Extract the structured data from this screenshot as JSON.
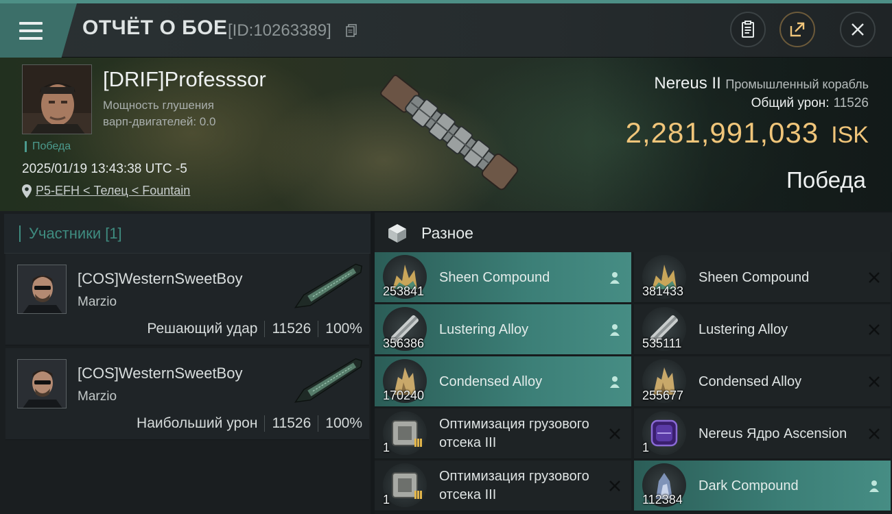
{
  "header": {
    "title": "ОТЧЁТ О БОЕ",
    "report_id": "[ID:10263389]"
  },
  "victim": {
    "pilot_name": "[DRIF]Professsor",
    "jam_label_line1": "Мощность глушения",
    "jam_label_line2": "варп-двигателей: 0.0",
    "result_badge": "Победа",
    "datetime": "2025/01/19 13:43:38 UTC -5",
    "location": "P5-EFH < Телец < Fountain",
    "ship_name": "Nereus II",
    "ship_class": "Промышленный корабль",
    "total_damage_label": "Общий урон:",
    "total_damage_value": "11526",
    "isk_amount": "2,281,991,033",
    "isk_unit": "ISK",
    "outcome": "Победа"
  },
  "participants_tab": "Участники [1]",
  "participants": [
    {
      "name": "[COS]WesternSweetBoy",
      "ship": "Marzio",
      "role": "Решающий удар",
      "damage": "11526",
      "percent": "100%"
    },
    {
      "name": "[COS]WesternSweetBoy",
      "ship": "Marzio",
      "role": "Наибольший урон",
      "damage": "11526",
      "percent": "100%"
    }
  ],
  "items_header": "Разное",
  "items": [
    {
      "name": "Sheen Compound",
      "qty": "253841",
      "dropped": true,
      "icon": "compound-crystal-icon"
    },
    {
      "name": "Sheen Compound",
      "qty": "381433",
      "dropped": false,
      "icon": "compound-crystal-icon"
    },
    {
      "name": "Lustering Alloy",
      "qty": "356386",
      "dropped": true,
      "icon": "alloy-bar-icon"
    },
    {
      "name": "Lustering Alloy",
      "qty": "535111",
      "dropped": false,
      "icon": "alloy-bar-icon"
    },
    {
      "name": "Condensed Alloy",
      "qty": "170240",
      "dropped": true,
      "icon": "condensed-alloy-icon"
    },
    {
      "name": "Condensed Alloy",
      "qty": "255677",
      "dropped": false,
      "icon": "condensed-alloy-icon"
    },
    {
      "name": "Оптимизация грузового отсека III",
      "qty": "1",
      "dropped": false,
      "icon": "cargo-rig-icon"
    },
    {
      "name": "Nereus Ядро Ascension",
      "qty": "1",
      "dropped": false,
      "icon": "ship-core-icon"
    },
    {
      "name": "Оптимизация грузового отсека III",
      "qty": "1",
      "dropped": false,
      "icon": "cargo-rig-icon"
    },
    {
      "name": "Dark Compound",
      "qty": "112384",
      "dropped": true,
      "icon": "dark-compound-icon"
    }
  ],
  "colors": {
    "accent": "#4d8f86",
    "isk": "#f0c57a",
    "dropped_row": "#3c7f77"
  }
}
